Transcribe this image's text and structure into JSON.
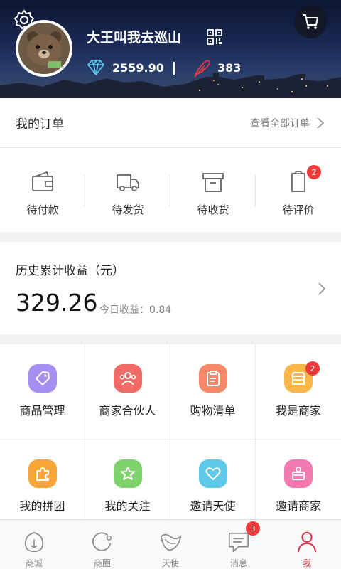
{
  "header": {
    "username": "大王叫我去巡山",
    "diamond_value": "2559.90",
    "feather_value": "383"
  },
  "orders": {
    "title": "我的订单",
    "view_all": "查看全部订单",
    "items": [
      {
        "label": "待付款",
        "icon": "wallet-icon"
      },
      {
        "label": "待发货",
        "icon": "truck-icon"
      },
      {
        "label": "待收货",
        "icon": "box-icon"
      },
      {
        "label": "待评价",
        "icon": "review-icon",
        "badge": "2"
      }
    ]
  },
  "earnings": {
    "title": "历史累计收益（元）",
    "total": "329.26",
    "today": "今日收益：0.84"
  },
  "features": [
    {
      "label": "商品管理",
      "icon": "tag-icon",
      "color": "#a48ef0"
    },
    {
      "label": "商家合伙人",
      "icon": "people-icon",
      "color": "#f26b66"
    },
    {
      "label": "购物清单",
      "icon": "clipboard-icon",
      "color": "#f5896a"
    },
    {
      "label": "我是商家",
      "icon": "store-icon",
      "color": "#f8b54a",
      "badge": "2"
    },
    {
      "label": "我的拼团",
      "icon": "puzzle-icon",
      "color": "#f8a63c"
    },
    {
      "label": "我的关注",
      "icon": "star-icon",
      "color": "#7fd36b"
    },
    {
      "label": "邀请天使",
      "icon": "heart-icon",
      "color": "#5ec9e8"
    },
    {
      "label": "邀请商家",
      "icon": "shop-icon",
      "color": "#f27ab0"
    }
  ],
  "tabbar": {
    "items": [
      {
        "label": "商城",
        "icon": "mall-icon"
      },
      {
        "label": "商圈",
        "icon": "circle-icon"
      },
      {
        "label": "天使",
        "icon": "wing-icon"
      },
      {
        "label": "消息",
        "icon": "message-icon",
        "badge": "3"
      },
      {
        "label": "我",
        "icon": "person-icon",
        "active": true
      }
    ]
  },
  "colors": {
    "accent": "#e6283f",
    "badge": "#f03a3a"
  }
}
